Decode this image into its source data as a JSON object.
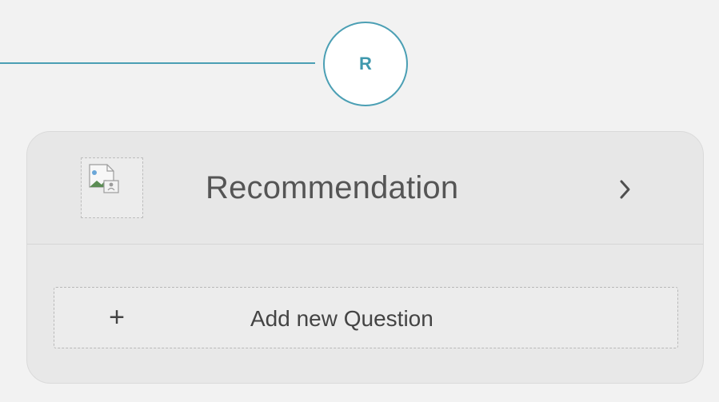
{
  "step_marker": {
    "letter": "R",
    "accent_color": "#4b9fb4"
  },
  "card": {
    "title": "Recommendation",
    "image_icon": "broken-image-icon",
    "chevron_icon": "chevron-right-icon"
  },
  "add_question": {
    "label": "Add new Question",
    "icon": "plus-icon"
  }
}
